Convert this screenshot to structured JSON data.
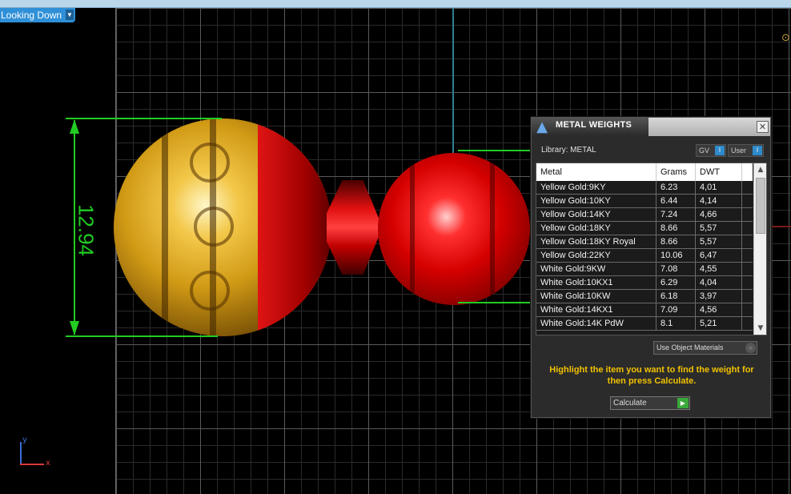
{
  "viewport": {
    "view_label": "Looking Down",
    "dimension_value": "12.94",
    "ucs": {
      "y_label": "y",
      "x_label": "x"
    }
  },
  "dialog": {
    "title": "METAL WEIGHTS",
    "library_label": "Library: METAL",
    "toggle_gv": "GV",
    "toggle_user": "User",
    "columns": [
      "Metal",
      "Grams",
      "DWT"
    ],
    "rows": [
      {
        "metal": "Yellow Gold:9KY",
        "grams": "6.23",
        "dwt": "4,01"
      },
      {
        "metal": "Yellow Gold:10KY",
        "grams": "6.44",
        "dwt": "4,14"
      },
      {
        "metal": "Yellow Gold:14KY",
        "grams": "7.24",
        "dwt": "4,66"
      },
      {
        "metal": "Yellow Gold:18KY",
        "grams": "8.66",
        "dwt": "5,57"
      },
      {
        "metal": "Yellow Gold:18KY Royal",
        "grams": "8.66",
        "dwt": "5,57"
      },
      {
        "metal": "Yellow Gold:22KY",
        "grams": "10.06",
        "dwt": "6,47"
      },
      {
        "metal": "White Gold:9KW",
        "grams": "7.08",
        "dwt": "4,55"
      },
      {
        "metal": "White Gold:10KX1",
        "grams": "6.29",
        "dwt": "4,04"
      },
      {
        "metal": "White Gold:10KW",
        "grams": "6.18",
        "dwt": "3,97"
      },
      {
        "metal": "White Gold:14KX1",
        "grams": "7.09",
        "dwt": "4,56"
      },
      {
        "metal": "White Gold:14K PdW",
        "grams": "8.1",
        "dwt": "5,21"
      }
    ],
    "use_object_materials": "Use Object Materials",
    "hint": "Highlight the item you want to find the weight for then press Calculate.",
    "calculate_label": "Calculate"
  },
  "colors": {
    "accent": "#2f90d8",
    "dimension": "#22cc22",
    "hint": "#f2c200",
    "gold": "#d19a15",
    "red": "#d40000"
  }
}
